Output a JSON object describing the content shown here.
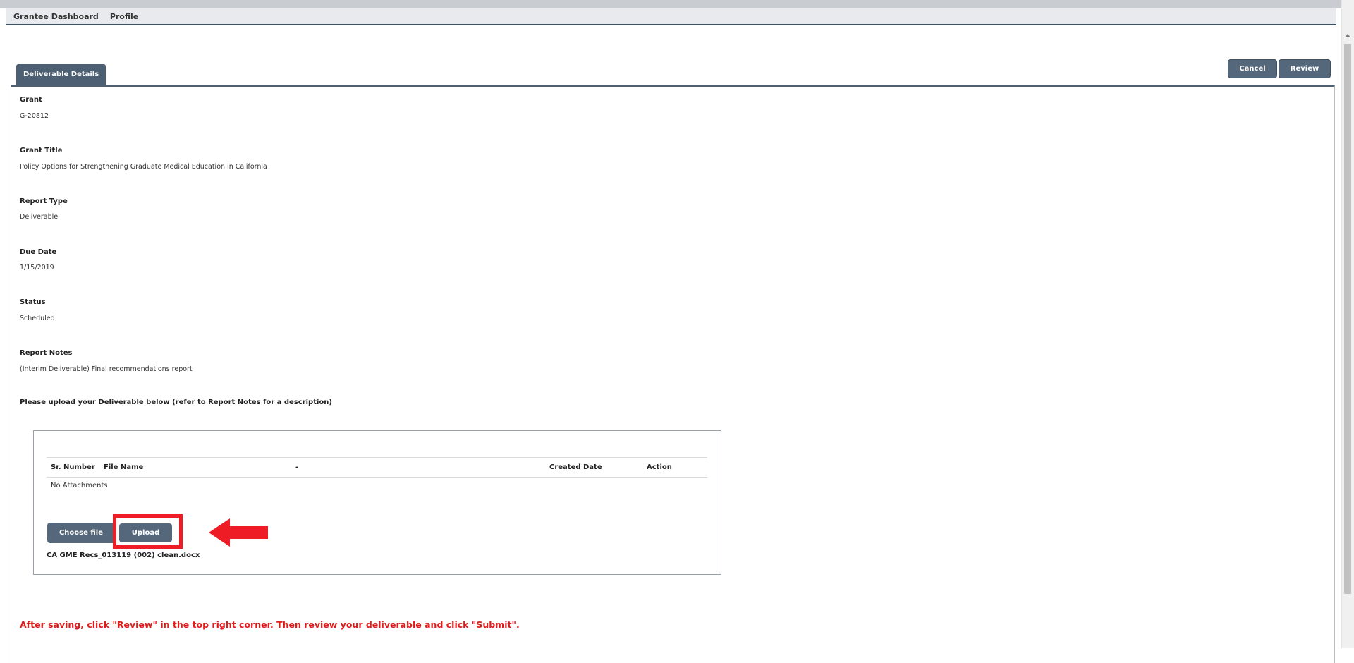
{
  "nav": {
    "items": [
      "Grantee Dashboard",
      "Profile"
    ]
  },
  "tab": {
    "label": "Deliverable Details"
  },
  "actions": {
    "cancel_label": "Cancel",
    "review_label": "Review"
  },
  "fields": [
    {
      "label": "Grant",
      "value": "G-20812"
    },
    {
      "label": "Grant Title",
      "value": "Policy Options for Strengthening Graduate Medical Education in California"
    },
    {
      "label": "Report Type",
      "value": "Deliverable"
    },
    {
      "label": "Due Date",
      "value": "1/15/2019"
    },
    {
      "label": "Status",
      "value": "Scheduled"
    },
    {
      "label": "Report Notes",
      "value": "(Interim Deliverable) Final recommendations report"
    }
  ],
  "upload": {
    "prompt": "Please upload your Deliverable below (refer to Report Notes for a description)",
    "table_headers": [
      "Sr. Number",
      "File Name",
      "-",
      "Created Date",
      "Action"
    ],
    "empty_text": "No Attachments",
    "choose_label": "Choose file",
    "upload_label": "Upload",
    "selected_file": "CA GME Recs_013119 (002) clean.docx"
  },
  "footer_note": "After saving, click \"Review\" in the top right corner. Then review your deliverable and click \"Submit\".",
  "colors": {
    "button_bg": "#55677b",
    "highlight": "#ee1c24",
    "note_text": "#e01b1b"
  }
}
